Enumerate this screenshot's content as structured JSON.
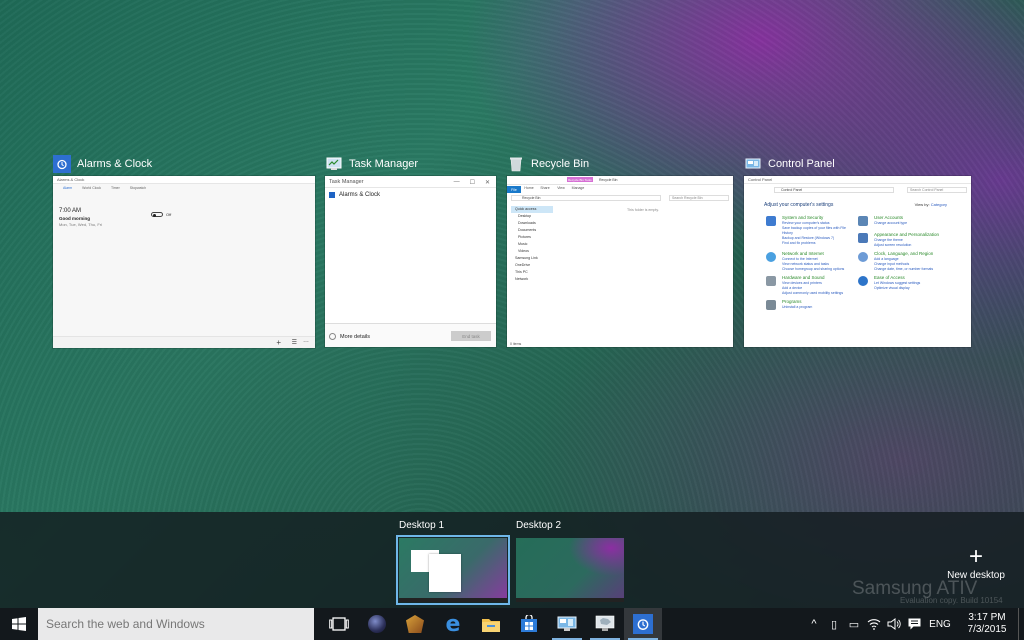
{
  "windows": [
    {
      "title": "Alarms & Clock",
      "icon": "alarm-clock-icon"
    },
    {
      "title": "Task Manager",
      "icon": "task-manager-icon"
    },
    {
      "title": "Recycle Bin",
      "icon": "recycle-bin-icon"
    },
    {
      "title": "Control Panel",
      "icon": "control-panel-icon"
    }
  ],
  "alarms_preview": {
    "tabs": [
      "Alarm",
      "World Clock",
      "Timer",
      "Stopwatch"
    ],
    "time": "7:00 AM",
    "name": "Good morning",
    "days": "Mon, Tue, Wed, Thu, Fri",
    "state": "Off"
  },
  "taskmanager_preview": {
    "title": "Task Manager",
    "app": "Alarms & Clock",
    "more_details": "More details",
    "end_task": "End task"
  },
  "recyclebin_preview": {
    "tools_tab": "Recycle Bin Tools",
    "tabs": [
      "File",
      "Home",
      "Share",
      "View",
      "Manage"
    ],
    "address": "Recycle Bin",
    "search": "Search Recycle Bin",
    "nav": [
      "Quick access",
      "Desktop",
      "Downloads",
      "Documents",
      "Pictures",
      "Music",
      "Videos",
      "Samsung Link",
      "OneDrive",
      "This PC",
      "Network"
    ],
    "empty_message": "This folder is empty.",
    "status": "0 items"
  },
  "controlpanel_preview": {
    "title": "Control Panel",
    "breadcrumb": "Control Panel",
    "search": "Search Control Panel",
    "heading": "Adjust your computer's settings",
    "view_by": "View by:",
    "view_value": "Category",
    "left": [
      {
        "cat": "System and Security",
        "subs": [
          "Review your computer's status",
          "Save backup copies of your files with File History",
          "Backup and Restore (Windows 7)",
          "Find and fix problems"
        ]
      },
      {
        "cat": "Network and Internet",
        "subs": [
          "Connect to the Internet",
          "View network status and tasks",
          "Choose homegroup and sharing options"
        ]
      },
      {
        "cat": "Hardware and Sound",
        "subs": [
          "View devices and printers",
          "Add a device",
          "Adjust commonly used mobility settings"
        ]
      },
      {
        "cat": "Programs",
        "subs": [
          "Uninstall a program"
        ]
      }
    ],
    "right": [
      {
        "cat": "User Accounts",
        "subs": [
          "Change account type"
        ]
      },
      {
        "cat": "Appearance and Personalization",
        "subs": [
          "Change the theme",
          "Adjust screen resolution"
        ]
      },
      {
        "cat": "Clock, Language, and Region",
        "subs": [
          "Add a language",
          "Change input methods",
          "Change date, time, or number formats"
        ]
      },
      {
        "cat": "Ease of Access",
        "subs": [
          "Let Windows suggest settings",
          "Optimize visual display"
        ]
      }
    ]
  },
  "desktops": [
    {
      "label": "Desktop 1",
      "active": true
    },
    {
      "label": "Desktop 2",
      "active": false
    }
  ],
  "new_desktop_label": "New desktop",
  "watermark": "Samsung ATIV",
  "eval_text": "Evaluation copy. Build 10154",
  "taskbar": {
    "search_placeholder": "Search the web and Windows",
    "apps": [
      "start-icon",
      "task-view-icon",
      "cortana-icon",
      "game-icon",
      "edge-icon",
      "file-explorer-icon",
      "store-icon",
      "control-panel-icon",
      "recycle-bin-icon",
      "alarm-clock-icon"
    ],
    "tray_language": "ENG",
    "time": "3:17 PM",
    "date": "7/3/2015"
  },
  "colors": {
    "accent": "#6fb7e9",
    "taskbar": "#13181c",
    "cp_category": "#2a8a2a",
    "cp_link": "#2a5bbf"
  }
}
